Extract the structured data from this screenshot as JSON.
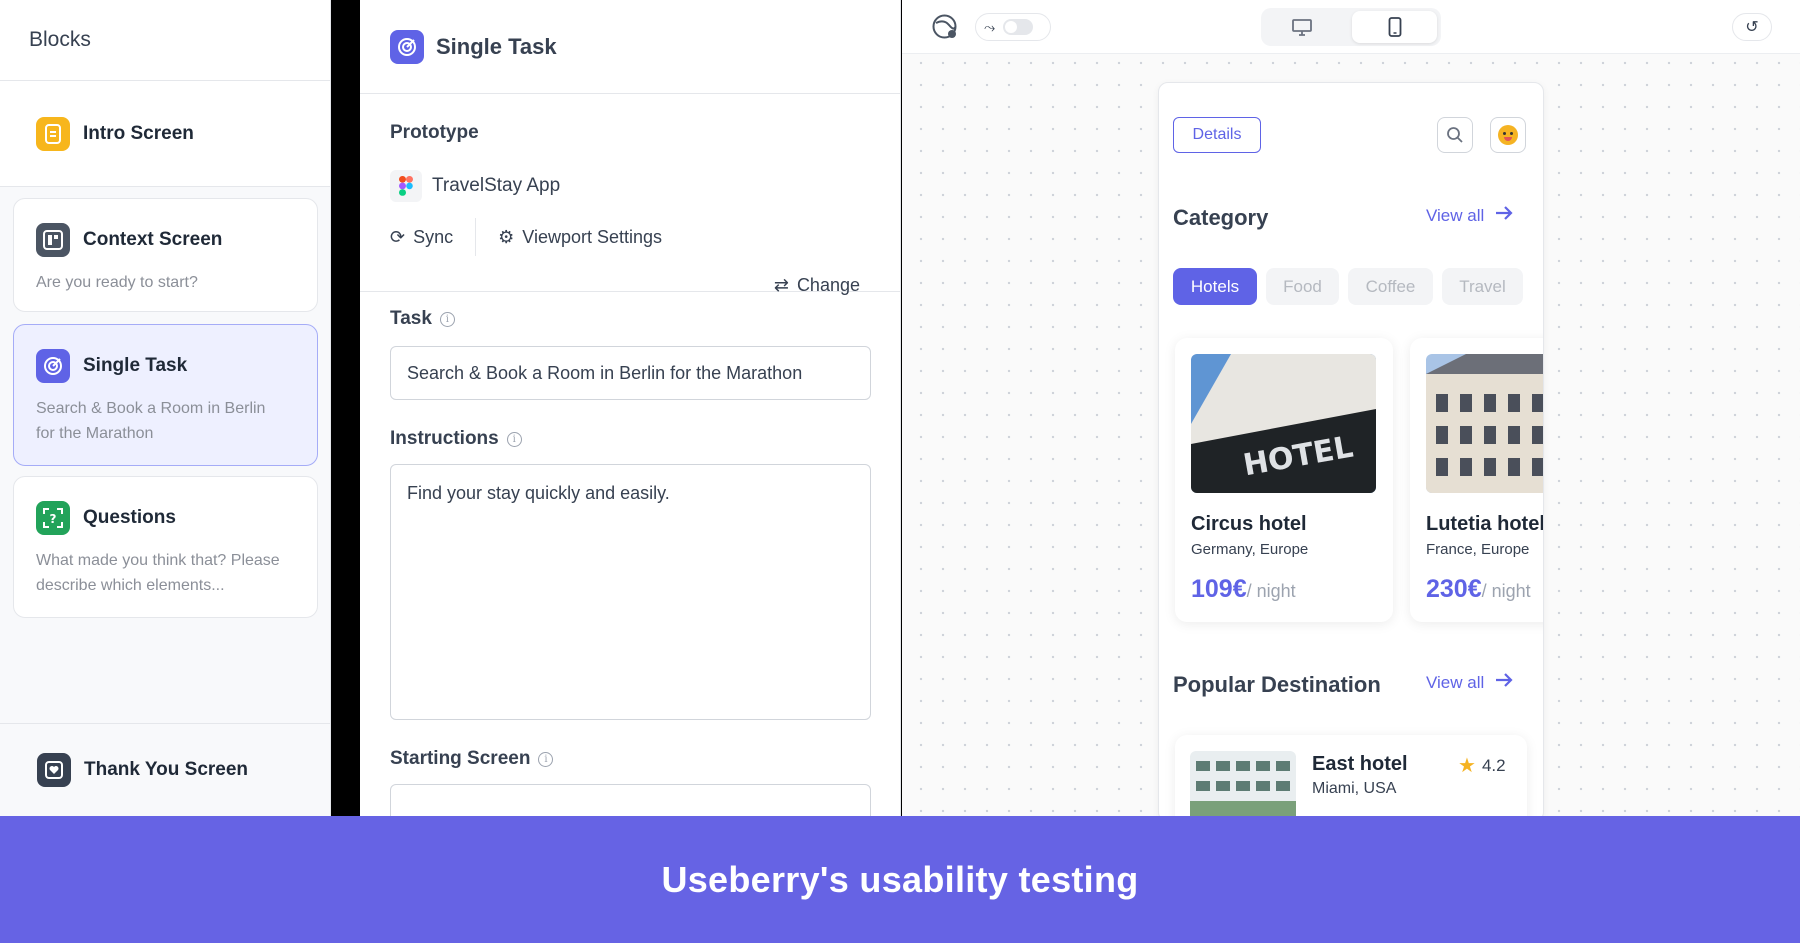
{
  "sidebar": {
    "header": "Blocks",
    "intro": {
      "title": "Intro Screen"
    },
    "blocks": [
      {
        "title": "Context Screen",
        "desc": "Are you ready to start?"
      },
      {
        "title": "Single Task",
        "desc": "Search & Book a Room in Berlin for the Marathon"
      },
      {
        "title": "Questions",
        "desc": "What made you think that? Please describe which elements..."
      }
    ],
    "thanks": {
      "title": "Thank You Screen"
    }
  },
  "editor": {
    "title": "Single Task",
    "prototype": {
      "label": "Prototype",
      "app_name": "TravelStay App",
      "change_label": "Change",
      "sync_label": "Sync",
      "viewport_label": "Viewport Settings"
    },
    "task": {
      "label": "Task",
      "value": "Search & Book a Room in Berlin for the Marathon"
    },
    "instructions": {
      "label": "Instructions",
      "value": "Find your stay quickly and easily."
    },
    "starting_screen": {
      "label": "Starting Screen"
    }
  },
  "preview": {
    "toolbar": {
      "desktop_icon": "monitor-icon",
      "mobile_icon": "phone-icon",
      "reset_icon": "reset-icon"
    },
    "app": {
      "details_label": "Details",
      "category_heading": "Category",
      "view_all": "View all",
      "chips": [
        "Hotels",
        "Food",
        "Coffee",
        "Travel"
      ],
      "hotels": [
        {
          "name": "Circus hotel",
          "location": "Germany, Europe",
          "price": "109€",
          "per": "/ night"
        },
        {
          "name": "Lutetia hotel",
          "location": "France, Europe",
          "price": "230€",
          "per": "/ night"
        }
      ],
      "popular_heading": "Popular Destination",
      "popular": [
        {
          "name": "East hotel",
          "location": "Miami, USA",
          "rating": "4.2"
        }
      ]
    }
  },
  "banner": {
    "text": "Useberry's usability testing"
  },
  "colors": {
    "accent": "#6663e4",
    "brand_blue": "#5f63e6",
    "banner": "#6663e4"
  }
}
